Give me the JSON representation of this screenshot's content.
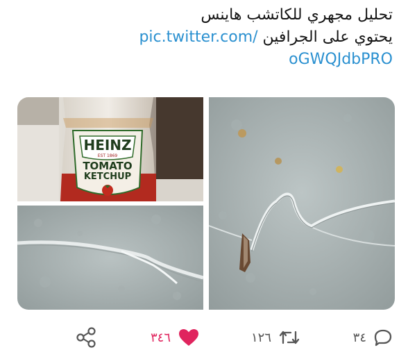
{
  "tweet": {
    "text_line1": "تحليل مجهري للكاتشب هاينس",
    "text_line2": "يحتوي على الجرافين",
    "link_part1": "pic.twitter.com/",
    "link_part2": "oGWQJdbPRO"
  },
  "media": {
    "ketchup_label_brand": "HEINZ",
    "ketchup_label_est": "EST 1869",
    "ketchup_label_line1": "TOMATO",
    "ketchup_label_line2": "KETCHUP"
  },
  "actions": {
    "reply_count": "٣٤",
    "retweet_count": "١٢٦",
    "like_count": "٣٤٦"
  },
  "colors": {
    "link": "#2a90d0",
    "like": "#e0245e",
    "icon": "#555555"
  }
}
